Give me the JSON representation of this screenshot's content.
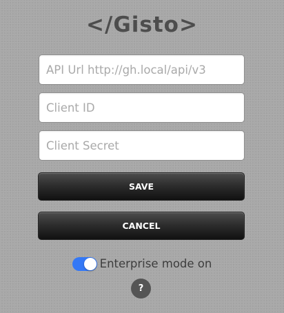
{
  "app": {
    "logo": "</Gisto>"
  },
  "form": {
    "api_url_placeholder": "API Url http://gh.local/api/v3",
    "api_url_value": "",
    "client_id_placeholder": "Client ID",
    "client_id_value": "",
    "client_secret_placeholder": "Client Secret",
    "client_secret_value": ""
  },
  "actions": {
    "save_label": "SAVE",
    "cancel_label": "CANCEL"
  },
  "enterprise": {
    "toggle_on": true,
    "label": "Enterprise mode on"
  },
  "help": {
    "label": "?",
    "icon": "help-icon"
  },
  "colors": {
    "background": "#a8a8a8",
    "toggle_accent": "#3478f6",
    "button_dark": "#1f1f1f",
    "help_circle": "#555555"
  }
}
